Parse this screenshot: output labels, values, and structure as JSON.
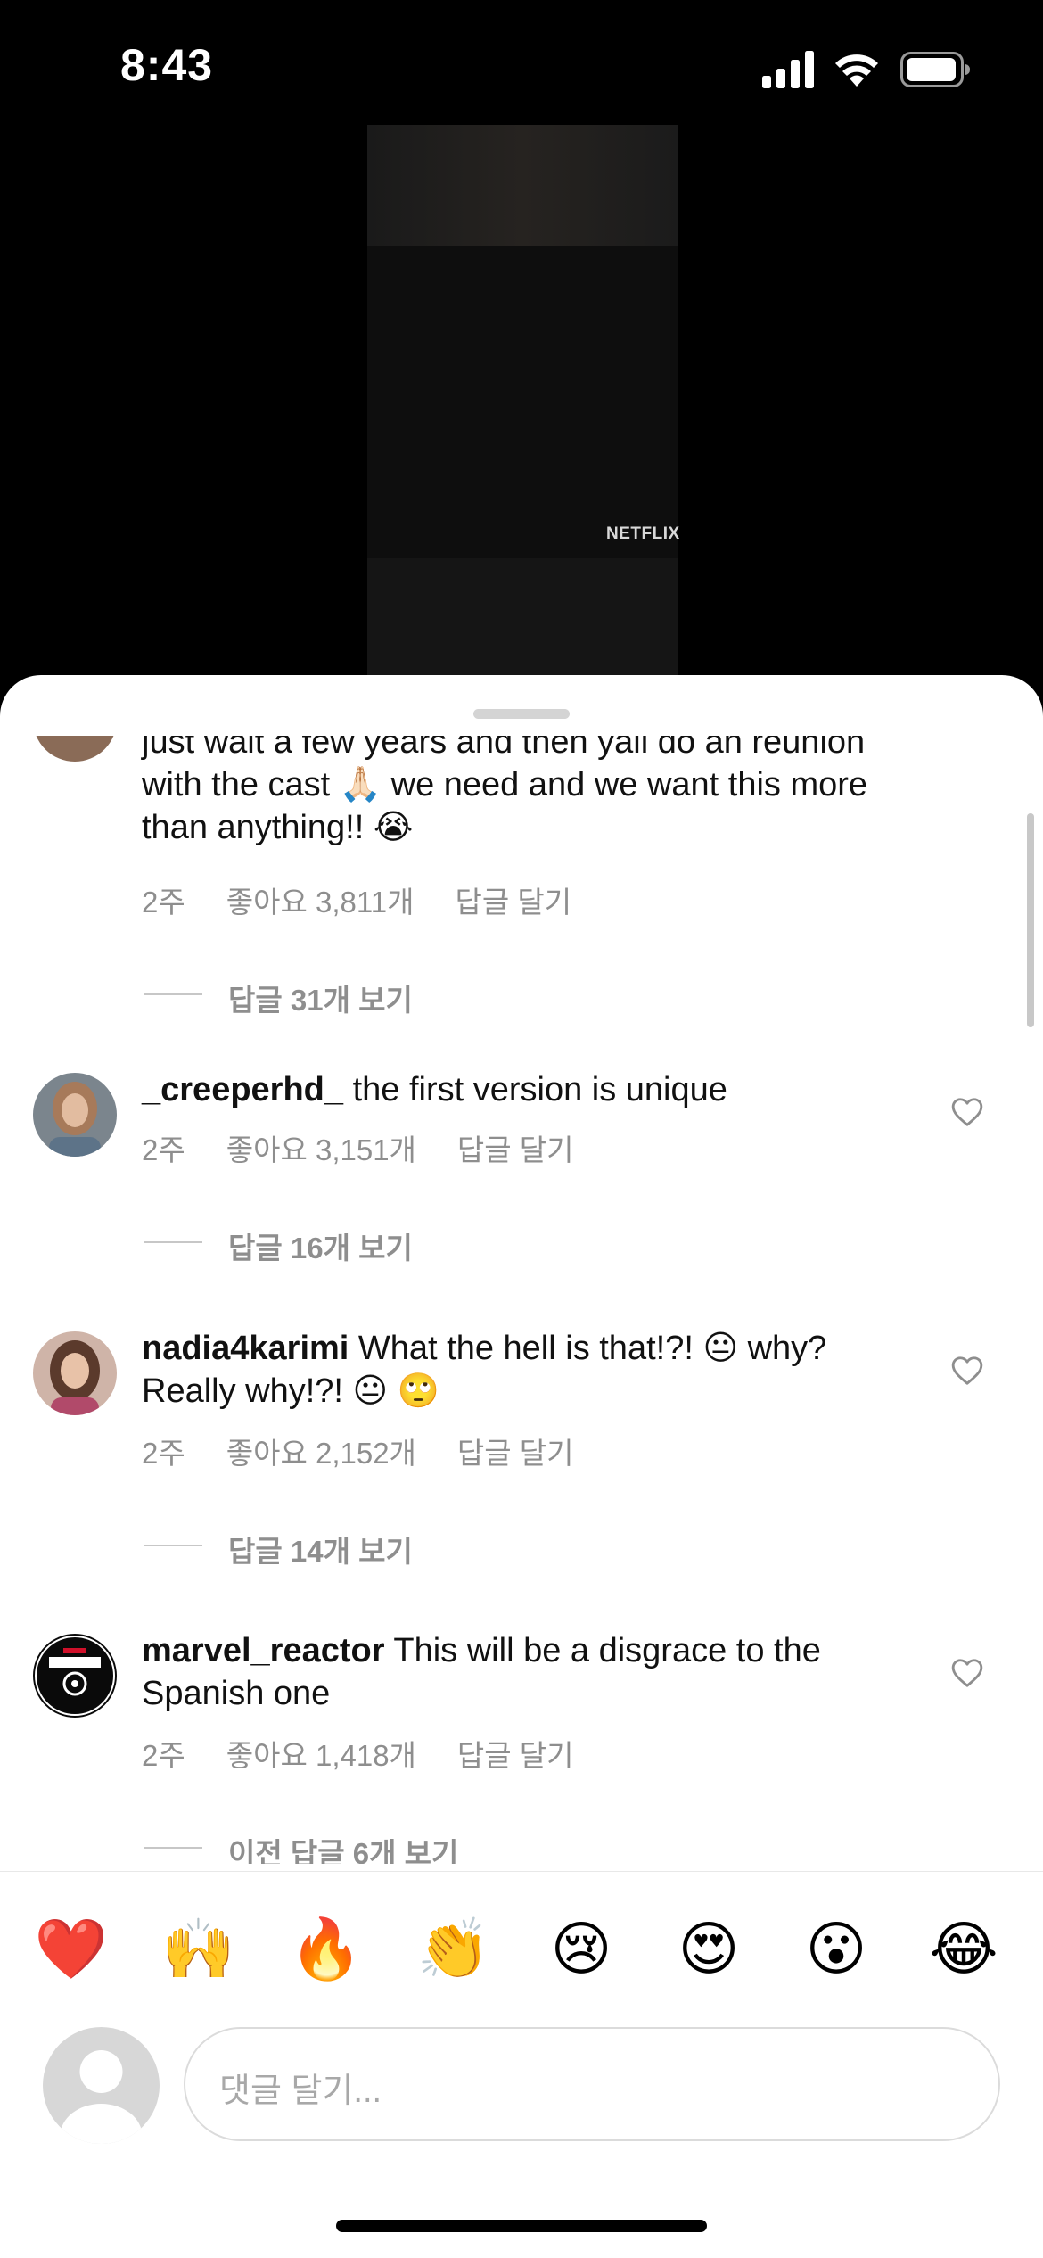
{
  "status_bar": {
    "time": "8:43"
  },
  "video": {
    "watermark": "NETFLIX"
  },
  "comments": [
    {
      "username": "",
      "text": "just wait a few years and then yall do an reunion with the cast 🙏🏻 we need and we want this more than anything!! 😭",
      "time": "2주",
      "likes": "좋아요 3,811개",
      "reply_label": "답글 달기",
      "view_replies": "답글 31개 보기"
    },
    {
      "username": "_creeperhd_",
      "text": "the first version is unique",
      "time": "2주",
      "likes": "좋아요 3,151개",
      "reply_label": "답글 달기",
      "view_replies": "답글 16개 보기"
    },
    {
      "username": "nadia4karimi",
      "text": "What the hell is that!?! 😐 why? Really why!?! 😐 🙄",
      "time": "2주",
      "likes": "좋아요 2,152개",
      "reply_label": "답글 달기",
      "view_replies": "답글 14개 보기"
    },
    {
      "username": "marvel_reactor",
      "text": "This will be a disgrace to the Spanish one",
      "time": "2주",
      "likes": "좋아요 1,418개",
      "reply_label": "답글 달기",
      "view_replies": "이전 답글 6개 보기"
    }
  ],
  "quick_reactions": [
    "❤️",
    "🙌",
    "🔥",
    "👏",
    "😢",
    "😍",
    "😮",
    "😂"
  ],
  "composer": {
    "placeholder": "댓글 달기..."
  },
  "icons": {
    "like": "heart-icon",
    "profile": "default-avatar-icon",
    "signal": "cellular-signal-icon",
    "wifi": "wifi-icon",
    "battery": "battery-icon"
  }
}
